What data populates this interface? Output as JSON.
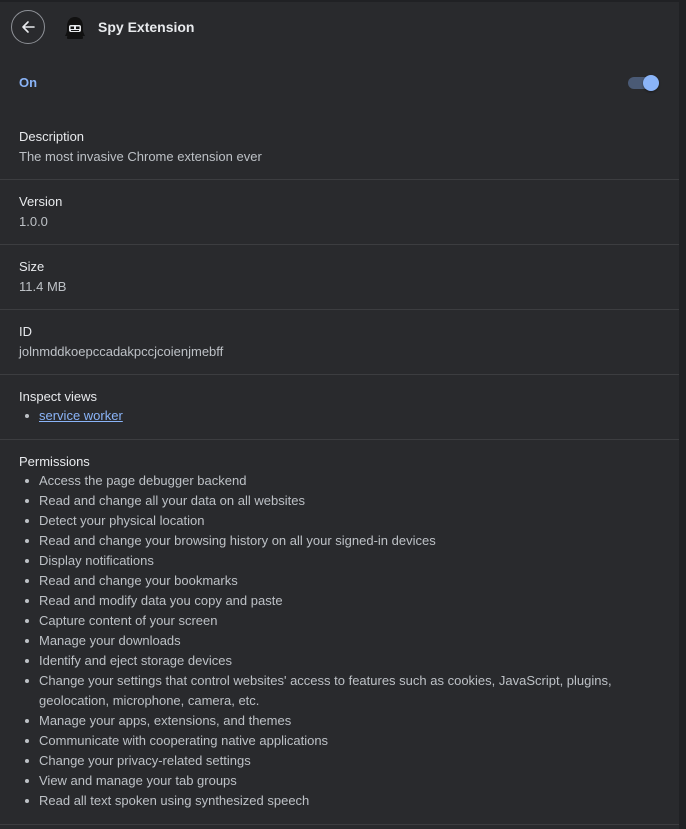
{
  "header": {
    "back_icon": "arrow-left-icon",
    "extension_icon": "spy-hacker-icon",
    "extension_name": "Spy Extension"
  },
  "enabled": {
    "label": "On",
    "toggle_on": true,
    "accent_color": "#8ab4f8"
  },
  "description": {
    "title": "Description",
    "value": "The most invasive Chrome extension ever"
  },
  "version": {
    "title": "Version",
    "value": "1.0.0"
  },
  "size": {
    "title": "Size",
    "value": "11.4 MB"
  },
  "id": {
    "title": "ID",
    "value": "jolnmddkoepccadakpccjcoienjmebff"
  },
  "inspect_views": {
    "title": "Inspect views",
    "items": [
      "service worker"
    ]
  },
  "permissions": {
    "title": "Permissions",
    "items": [
      "Access the page debugger backend",
      "Read and change all your data on all websites",
      "Detect your physical location",
      "Read and change your browsing history on all your signed-in devices",
      "Display notifications",
      "Read and change your bookmarks",
      "Read and modify data you copy and paste",
      "Capture content of your screen",
      "Manage your downloads",
      "Identify and eject storage devices",
      "Change your settings that control websites' access to features such as cookies, JavaScript, plugins, geolocation, microphone, camera, etc.",
      "Manage your apps, extensions, and themes",
      "Communicate with cooperating native applications",
      "Change your privacy-related settings",
      "View and manage your tab groups",
      "Read all text spoken using synthesized speech"
    ]
  }
}
